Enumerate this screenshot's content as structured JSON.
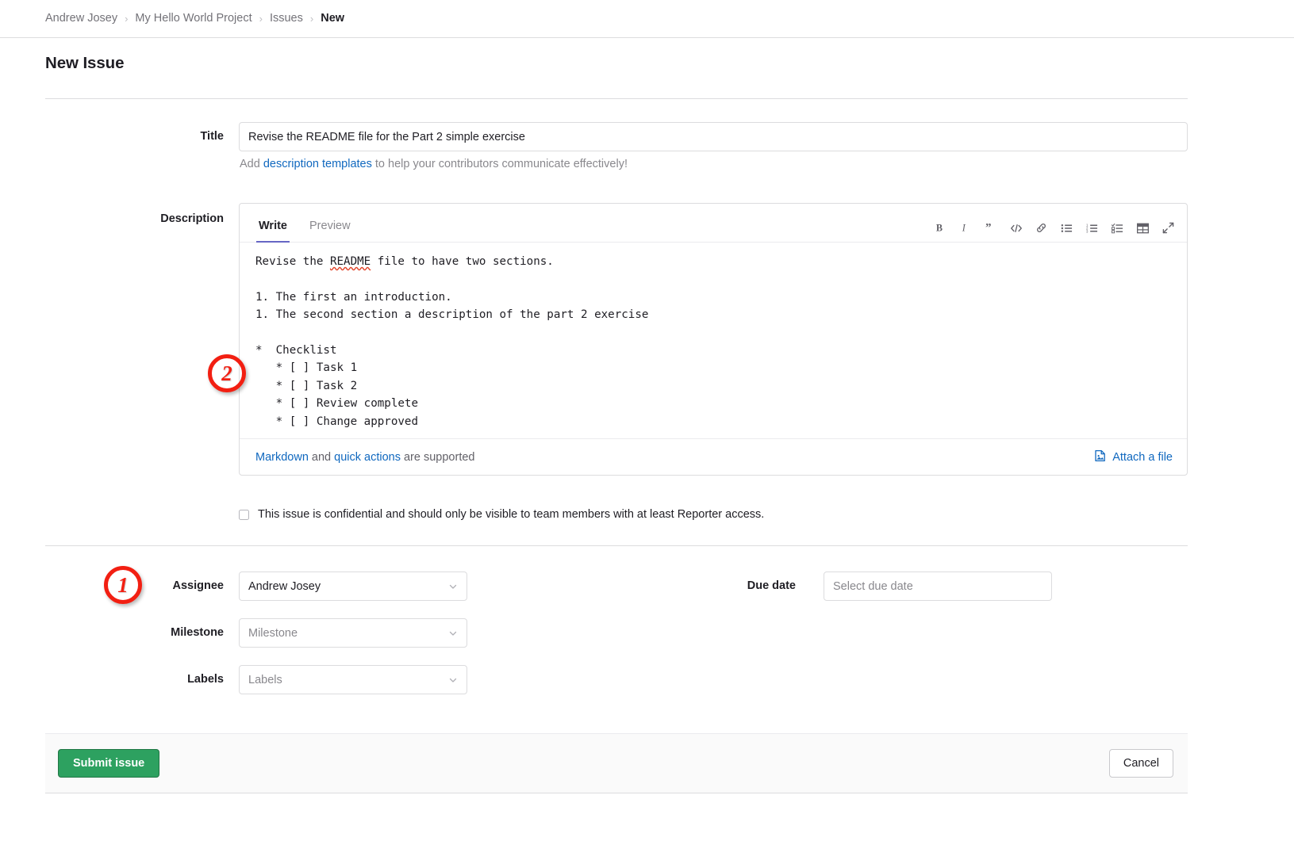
{
  "breadcrumb": {
    "items": [
      {
        "label": "Andrew Josey",
        "current": false
      },
      {
        "label": "My Hello World Project",
        "current": false
      },
      {
        "label": "Issues",
        "current": false
      },
      {
        "label": "New",
        "current": true
      }
    ],
    "separator": "›"
  },
  "page": {
    "title": "New Issue"
  },
  "title_field": {
    "label": "Title",
    "value": "Revise the README file for the Part 2 simple exercise",
    "placeholder": "Title",
    "helper_prefix": "Add ",
    "helper_link": "description templates",
    "helper_suffix": " to help your contributors communicate effectively!"
  },
  "description": {
    "label": "Description",
    "tabs": [
      {
        "label": "Write",
        "active": true
      },
      {
        "label": "Preview",
        "active": false
      }
    ],
    "toolbar": [
      {
        "name": "bold-icon",
        "title": "Bold"
      },
      {
        "name": "italic-icon",
        "title": "Italic"
      },
      {
        "name": "quote-icon",
        "title": "Insert a quote"
      },
      {
        "name": "code-icon",
        "title": "Insert code"
      },
      {
        "name": "link-icon",
        "title": "Add a link"
      },
      {
        "name": "bullet-list-icon",
        "title": "Add a bullet list"
      },
      {
        "name": "numbered-list-icon",
        "title": "Add a numbered list"
      },
      {
        "name": "task-list-icon",
        "title": "Add a checklist"
      },
      {
        "name": "table-icon",
        "title": "Add a table"
      },
      {
        "name": "fullscreen-icon",
        "title": "Go full screen"
      }
    ],
    "body_line1_pre": "Revise the ",
    "body_line1_spell": "README",
    "body_line1_post": " file to have two sections.",
    "body_rest": "\n\n1. The first an introduction.\n1. The second section a description of the part 2 exercise\n\n*  Checklist\n   * [ ] Task 1\n   * [ ] Task 2\n   * [ ] Review complete\n   * [ ] Change approved",
    "footer_link_markdown": "Markdown",
    "footer_and": " and ",
    "footer_link_quick": "quick actions",
    "footer_suffix": " are supported",
    "attach_label": "Attach a file"
  },
  "confidential": {
    "checked": false,
    "label": "This issue is confidential and should only be visible to team members with at least Reporter access."
  },
  "fields": {
    "assignee": {
      "label": "Assignee",
      "value": "Andrew Josey",
      "is_placeholder": false
    },
    "milestone": {
      "label": "Milestone",
      "value": "Milestone",
      "is_placeholder": true
    },
    "labels": {
      "label": "Labels",
      "value": "Labels",
      "is_placeholder": true
    },
    "due_date": {
      "label": "Due date",
      "value": "Select due date",
      "is_placeholder": true
    }
  },
  "footer": {
    "submit_label": "Submit issue",
    "cancel_label": "Cancel"
  },
  "annotations": [
    {
      "id": "annotation-1",
      "label": "1"
    },
    {
      "id": "annotation-2",
      "label": "2"
    }
  ],
  "colors": {
    "link": "#1068bf",
    "submit_green": "#2da160",
    "annotation_red": "#f21f12",
    "tab_underline": "#6666c4",
    "spellcheck_red": "#e24329"
  }
}
